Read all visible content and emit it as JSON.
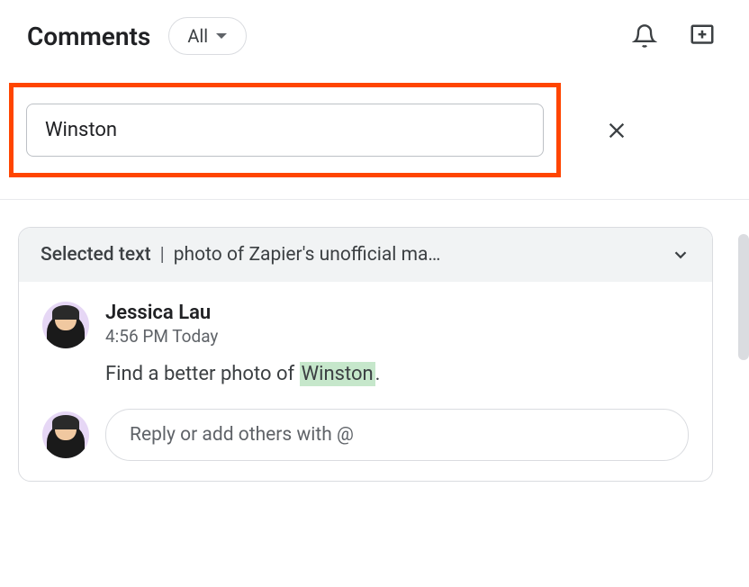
{
  "header": {
    "title": "Comments",
    "filter_label": "All"
  },
  "search": {
    "value": "Winston"
  },
  "card": {
    "header_label": "Selected text",
    "header_text": "photo of Zapier's unofficial ma…"
  },
  "comment": {
    "author": "Jessica Lau",
    "timestamp": "4:56 PM Today",
    "text_pre": "Find a better photo of ",
    "text_highlight": "Winston",
    "text_post": "."
  },
  "reply": {
    "placeholder": "Reply or add others with @"
  }
}
